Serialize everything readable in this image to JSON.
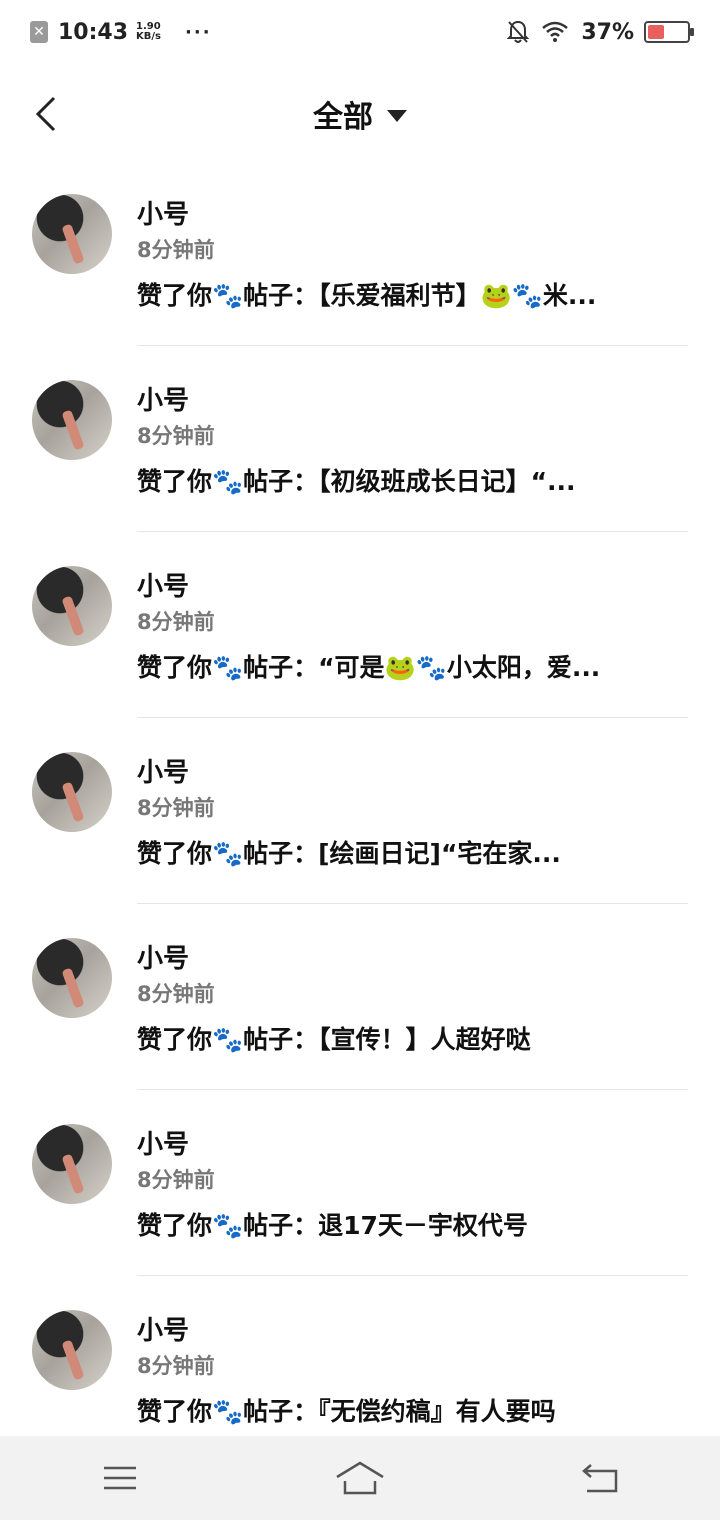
{
  "status_bar": {
    "time": "10:43",
    "speed_value": "1.90",
    "speed_unit": "KB/s",
    "more": "···",
    "battery": "37%",
    "battery_level": 0.37
  },
  "header": {
    "title": "全部"
  },
  "items": [
    {
      "name": "小号",
      "time": "8分钟前",
      "content": "赞了你🐾帖子：【乐爱福利节】🐸🐾米..."
    },
    {
      "name": "小号",
      "time": "8分钟前",
      "content": "赞了你🐾帖子：【初级班成长日记】“..."
    },
    {
      "name": "小号",
      "time": "8分钟前",
      "content": "赞了你🐾帖子：“可是🐸🐾小太阳，爱..."
    },
    {
      "name": "小号",
      "time": "8分钟前",
      "content": "赞了你🐾帖子：[绘画日记]“宅在家..."
    },
    {
      "name": "小号",
      "time": "8分钟前",
      "content": "赞了你🐾帖子：【宣传！】人超好哒"
    },
    {
      "name": "小号",
      "time": "8分钟前",
      "content": "赞了你🐾帖子：退17天－宇权代号"
    },
    {
      "name": "小号",
      "time": "8分钟前",
      "content": "赞了你🐾帖子：『无偿约稿』有人要吗"
    }
  ],
  "icons": {
    "back": "chevron-left-icon",
    "dropdown": "caret-down-icon",
    "menu": "menu-icon",
    "home": "home-icon",
    "return": "return-icon"
  }
}
